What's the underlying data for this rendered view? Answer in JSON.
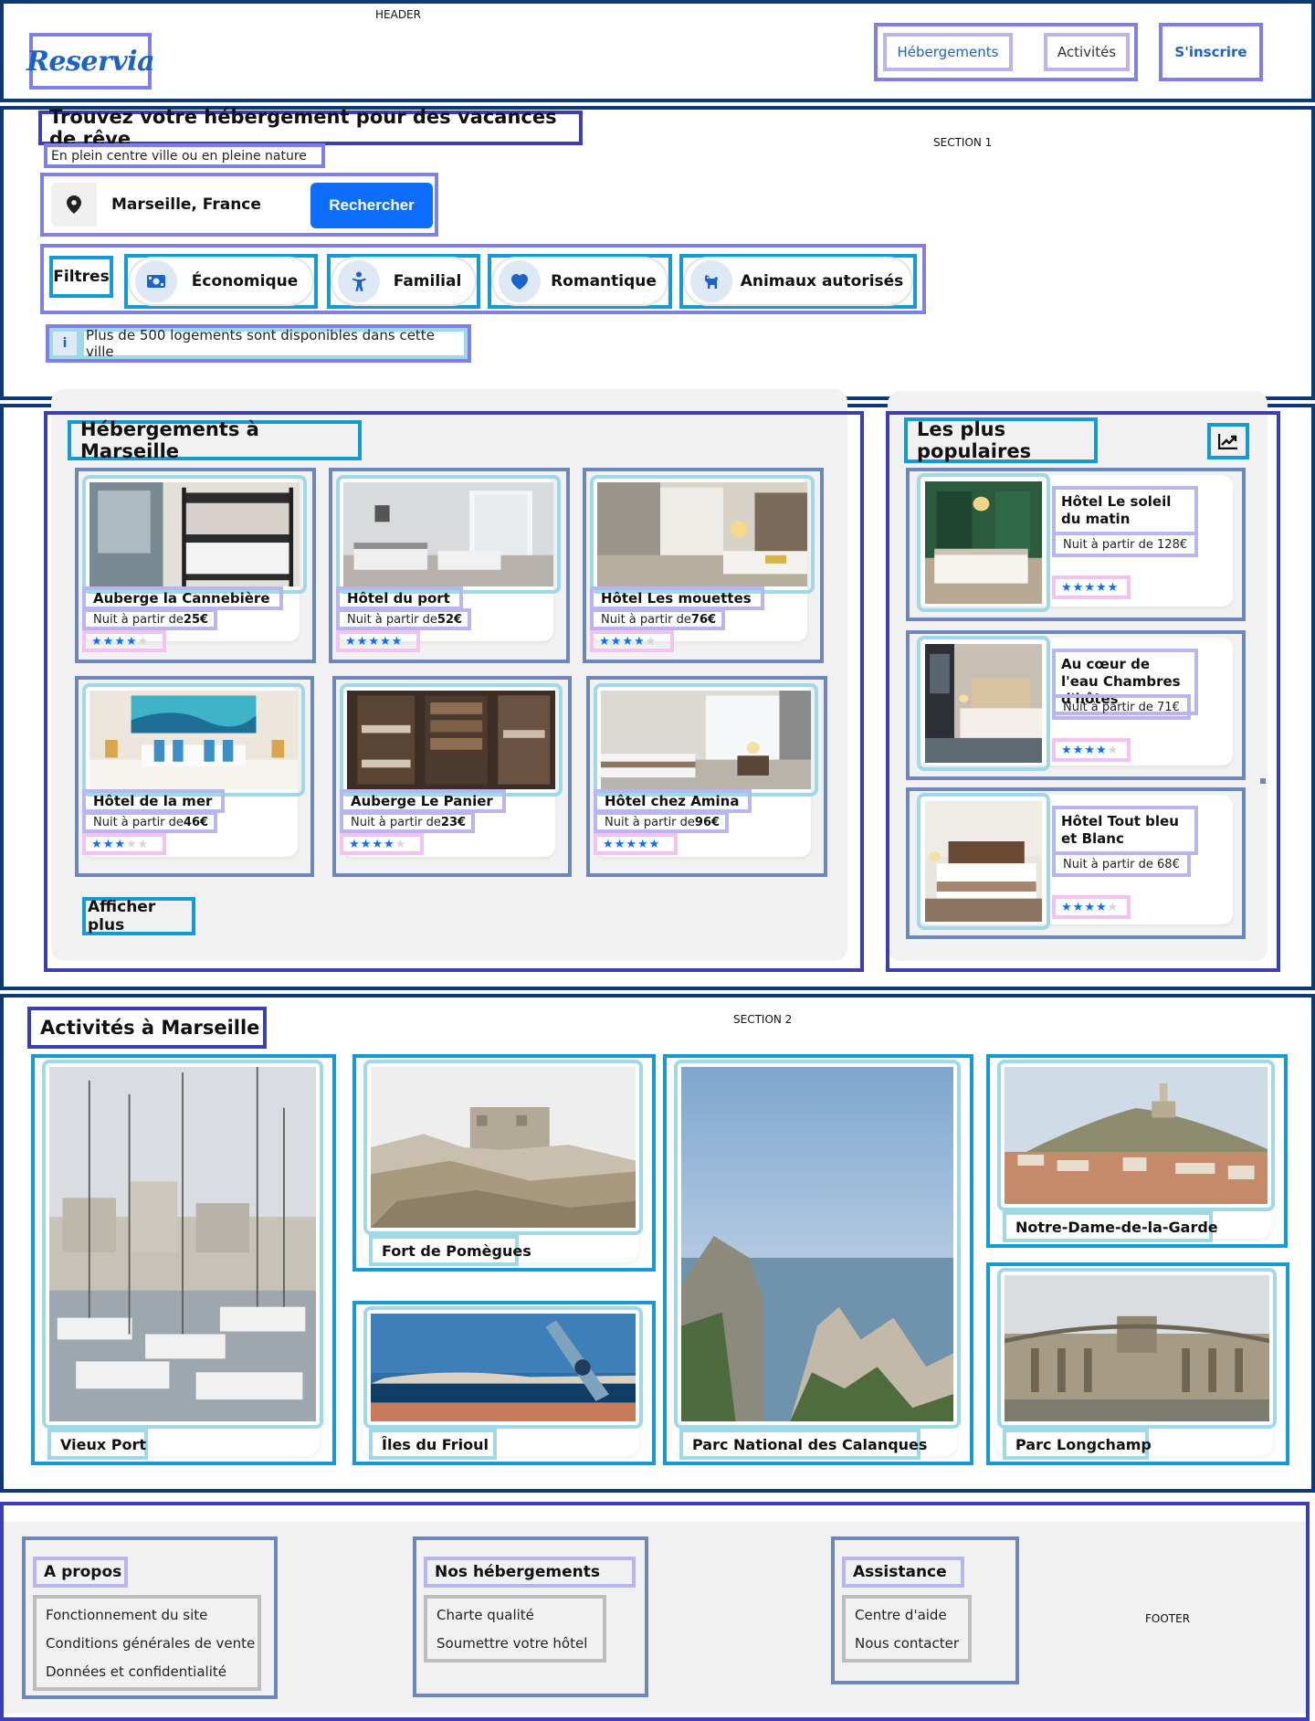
{
  "labels": {
    "header": "HEADER",
    "section1": "SECTION 1",
    "section2": "SECTION 2",
    "footer": "FOOTER"
  },
  "header": {
    "logo": "Reservia",
    "nav": [
      "Hébergements",
      "Activités"
    ],
    "signup": "S'inscrire"
  },
  "hero": {
    "title": "Trouvez votre hébergement pour des vacances de rêve",
    "subtitle": "En plein centre ville ou en pleine nature",
    "search_value": "Marseille, France",
    "search_button": "Rechercher",
    "filters_label": "Filtres",
    "filters": [
      {
        "label": "Économique",
        "icon": "money-icon"
      },
      {
        "label": "Familial",
        "icon": "child-icon"
      },
      {
        "label": "Romantique",
        "icon": "heart-icon"
      },
      {
        "label": "Animaux autorisés",
        "icon": "dog-icon"
      }
    ],
    "info_icon": "i",
    "info": "Plus de 500 logements sont disponibles dans cette ville"
  },
  "hotels": {
    "title": "Hébergements à Marseille",
    "price_prefix": "Nuit à partir de ",
    "items": [
      {
        "name": "Auberge la Cannebière",
        "price": "25€",
        "rating": 4
      },
      {
        "name": "Hôtel du port",
        "price": "52€",
        "rating": 5
      },
      {
        "name": "Hôtel Les mouettes",
        "price": "76€",
        "rating": 4
      },
      {
        "name": "Hôtel de la mer",
        "price": "46€",
        "rating": 3
      },
      {
        "name": "Auberge Le Panier",
        "price": "23€",
        "rating": 4
      },
      {
        "name": "Hôtel chez Amina",
        "price": "96€",
        "rating": 5
      }
    ],
    "more": "Afficher plus"
  },
  "popular": {
    "title": "Les plus populaires",
    "icon": "trend-icon",
    "items": [
      {
        "name": "Hôtel Le soleil du matin",
        "price": "Nuit à partir de 128€",
        "rating": 5
      },
      {
        "name": "Au cœur de l'eau Chambres d'hôtes",
        "price": "Nuit à partir de 71€",
        "rating": 4
      },
      {
        "name": "Hôtel Tout bleu et Blanc",
        "price": "Nuit à partir de 68€",
        "rating": 4
      }
    ]
  },
  "activities": {
    "title": "Activités à Marseille",
    "items": [
      "Vieux Port",
      "Fort de Pomègues",
      "Îles du Frioul",
      "Parc National des Calanques",
      "Notre-Dame-de-la-Garde",
      "Parc Longchamp"
    ]
  },
  "footer": {
    "columns": [
      {
        "title": "A propos",
        "links": [
          "Fonctionnement du site",
          "Conditions générales de vente",
          "Données et confidentialité"
        ]
      },
      {
        "title": "Nos hébergements",
        "links": [
          "Charte qualité",
          "Soumettre votre hôtel"
        ]
      },
      {
        "title": "Assistance",
        "links": [
          "Centre d'aide",
          "Nous contacter"
        ]
      }
    ]
  },
  "colors": {
    "accent": "#0d6efd",
    "brand": "#1b63c6"
  }
}
